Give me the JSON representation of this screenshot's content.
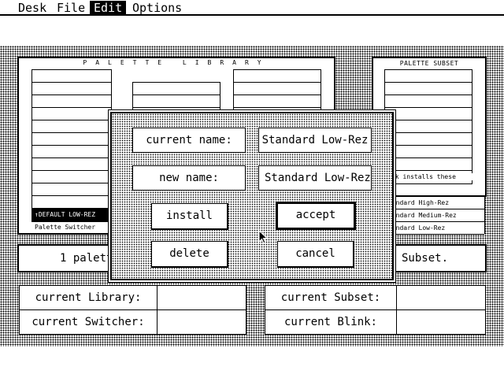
{
  "menubar": {
    "items": [
      {
        "label": "Desk"
      },
      {
        "label": "File"
      },
      {
        "label": "Edit"
      },
      {
        "label": "Options"
      }
    ]
  },
  "library": {
    "title": "PALETTE LIBRARY",
    "switcher_selected": "↑DEFAULT LOW-REZ",
    "switcher_caption": "Palette Switcher"
  },
  "subset": {
    "title": "PALETTE SUBSET",
    "blink_caption": "nk installs these",
    "items": [
      "tandard High-Rez",
      "tandard Medium-Rez",
      "tandard Low-Rez"
    ]
  },
  "status": {
    "left": "1 palett",
    "right": "Subset."
  },
  "info": {
    "library_label": "current Library:",
    "switcher_label": "current Switcher:",
    "subset_label": "current Subset:",
    "blink_label": "current Blink:",
    "library_value": "",
    "switcher_value": "",
    "subset_value": "",
    "blink_value": ""
  },
  "dialog": {
    "current_name_label": "current name:",
    "current_name_value": "Standard Low-Rez",
    "new_name_label": "new name:",
    "new_name_value": "Standard Low-Rez",
    "install": "install",
    "accept": "accept",
    "delete": "delete",
    "cancel": "cancel"
  }
}
